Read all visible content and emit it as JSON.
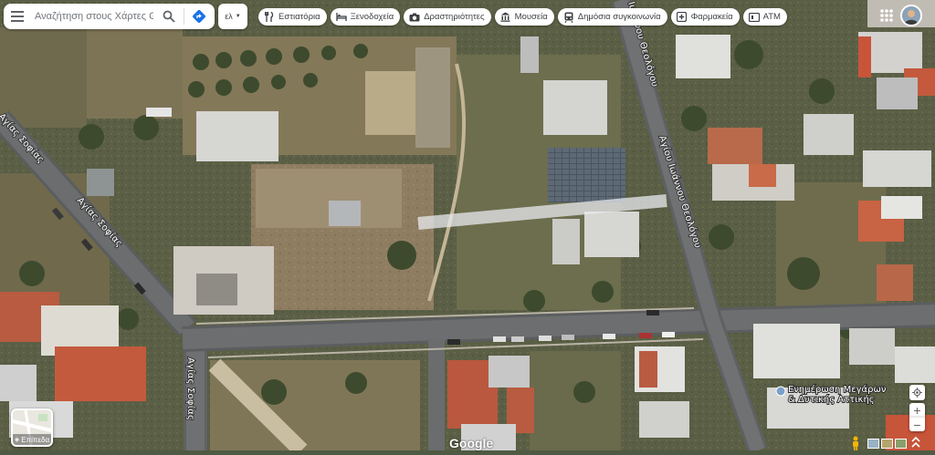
{
  "search": {
    "placeholder": "Αναζήτηση στους Χάρτες Goog"
  },
  "lang_label": "ελ",
  "chips": [
    {
      "label": "Εστιατόρια",
      "icon": "restaurant-icon"
    },
    {
      "label": "Ξενοδοχεία",
      "icon": "hotel-icon"
    },
    {
      "label": "Δραστηριότητες",
      "icon": "camera-icon"
    },
    {
      "label": "Μουσεία",
      "icon": "museum-icon"
    },
    {
      "label": "Δημόσια συγκοινωνία",
      "icon": "transit-icon"
    },
    {
      "label": "Φαρμακεία",
      "icon": "pharmacy-icon"
    },
    {
      "label": "ATM",
      "icon": "atm-icon"
    }
  ],
  "roads": {
    "agias_sofias_upper": "Αγίας Σοφίας",
    "agias_sofias_upper_left": "Αγίας Σοφίας",
    "agias_sofias_lower": "Αγίας Σοφίας",
    "ioannou_theologou_top": "Ιωάννου Θεολόγου",
    "ioannou_theologou_mid": "Αγίου Ιωάννου Θεολόγου"
  },
  "poi": {
    "line1": "Ενημέρωση Μεγάρων",
    "line2": "& Δυτικής Αττικής"
  },
  "layer_button": {
    "label": "Επίπεδα"
  },
  "google_logo": "Google",
  "colors": {
    "accent_blue": "#1a73e8",
    "chip_text": "#3c4043",
    "measure_line": "#e8eaed"
  }
}
